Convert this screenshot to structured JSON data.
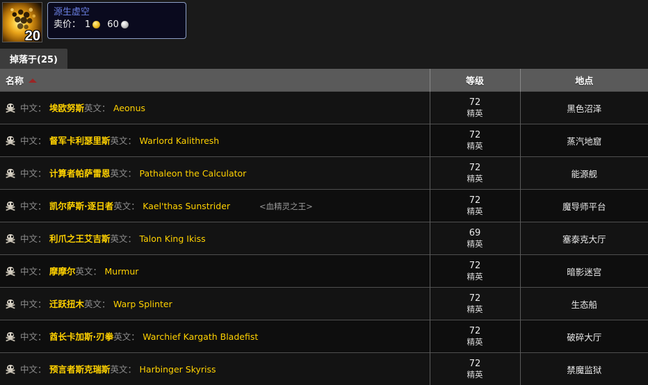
{
  "item": {
    "icon_name": "primal-nether-icon",
    "stack_count": "20",
    "tooltip": {
      "title": "源生虚空",
      "price_label": "卖价：",
      "gold_amount": "1",
      "gold_icon": "gold-coin-icon",
      "silver_amount": "60",
      "silver_icon": "silver-coin-icon"
    },
    "colors": {
      "quality_rare": "#6a7fe0",
      "tooltip_bg": "#0a0a1e",
      "tooltip_border": "#8ea0c8",
      "name_yellow": "#ffd100",
      "header_bg": "#5a5a5a",
      "sort_triangle": "#9b2525"
    }
  },
  "tab": {
    "label": "掉落于(25)"
  },
  "table": {
    "headers": {
      "name": "名称",
      "level": "等级",
      "zone": "地点"
    },
    "sort": {
      "column": "名称",
      "direction": "ascending",
      "icon": "sort-ascending-triangle-icon"
    },
    "row_labels": {
      "chinese": "中文：",
      "english": "英文："
    },
    "elite_label": "精英",
    "rows": [
      {
        "icon": "skull-icon",
        "name_cn": "埃欧努斯",
        "name_en": "Aeonus",
        "subtitle": "",
        "level": "72",
        "elite": "精英",
        "zone": "黑色沼泽"
      },
      {
        "icon": "skull-icon",
        "name_cn": "督军卡利瑟里斯",
        "name_en": "Warlord Kalithresh",
        "subtitle": "",
        "level": "72",
        "elite": "精英",
        "zone": "蒸汽地窟"
      },
      {
        "icon": "skull-icon",
        "name_cn": "计算者帕萨雷恩",
        "name_en": "Pathaleon the Calculator",
        "subtitle": "",
        "level": "72",
        "elite": "精英",
        "zone": "能源舰"
      },
      {
        "icon": "skull-icon",
        "name_cn": "凯尔萨斯·逐日者",
        "name_en": "Kael'thas Sunstrider",
        "subtitle": "<血精灵之王>",
        "level": "72",
        "elite": "精英",
        "zone": "魔导师平台"
      },
      {
        "icon": "skull-icon",
        "name_cn": "利爪之王艾吉斯",
        "name_en": "Talon King Ikiss",
        "subtitle": "",
        "level": "69",
        "elite": "精英",
        "zone": "塞泰克大厅"
      },
      {
        "icon": "skull-icon",
        "name_cn": "摩摩尔",
        "name_en": "Murmur",
        "subtitle": "",
        "level": "72",
        "elite": "精英",
        "zone": "暗影迷宫"
      },
      {
        "icon": "skull-icon",
        "name_cn": "迁跃扭木",
        "name_en": "Warp Splinter",
        "subtitle": "",
        "level": "72",
        "elite": "精英",
        "zone": "生态船"
      },
      {
        "icon": "skull-icon",
        "name_cn": "酋长卡加斯·刃拳",
        "name_en": "Warchief Kargath Bladefist",
        "subtitle": "",
        "level": "72",
        "elite": "精英",
        "zone": "破碎大厅"
      },
      {
        "icon": "skull-icon",
        "name_cn": "预言者斯克瑞斯",
        "name_en": "Harbinger Skyriss",
        "subtitle": "",
        "level": "72",
        "elite": "精英",
        "zone": "禁魔监狱"
      }
    ]
  }
}
